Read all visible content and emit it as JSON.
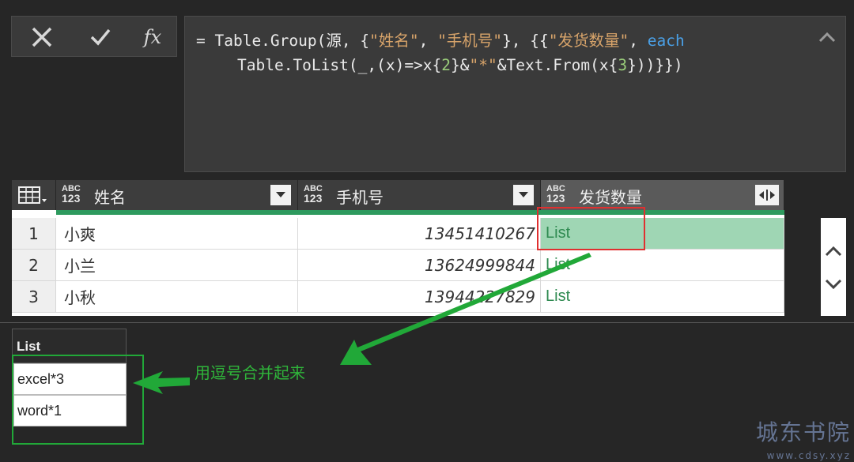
{
  "formula_bar": {
    "cancel_icon": "close-icon",
    "ok_icon": "check-icon",
    "fx_label": "fx",
    "line1": {
      "eq": "= Table.Group(源, {",
      "s1": "\"姓名\"",
      "c1": ", ",
      "s2": "\"手机号\"",
      "c2": "}, {{",
      "s3": "\"发货数量\"",
      "c3": ", ",
      "kw": "each"
    },
    "line2": {
      "a": "Table.ToList(_,(x)=>x{",
      "n1": "2",
      "b": "}&",
      "s": "\"*\"",
      "c": "&Text.From(x{",
      "n2": "3",
      "d": "}))}})"
    }
  },
  "columns": [
    {
      "type_top": "ABC",
      "type_bottom": "123",
      "label": "姓名"
    },
    {
      "type_top": "ABC",
      "type_bottom": "123",
      "label": "手机号"
    },
    {
      "type_top": "ABC",
      "type_bottom": "123",
      "label": "发货数量"
    }
  ],
  "rows": [
    {
      "index": "1",
      "name": "小爽",
      "phone": "13451410267",
      "value": "List"
    },
    {
      "index": "2",
      "name": "小兰",
      "phone": "13624999844",
      "value": "List"
    },
    {
      "index": "3",
      "name": "小秋",
      "phone": "13944227829",
      "value": "List"
    }
  ],
  "preview": {
    "header": "List",
    "items": [
      "excel*3",
      "word*1"
    ]
  },
  "annotation": "用逗号合并起来",
  "watermark": {
    "title": "城东书院",
    "url": "www.cdsy.xyz"
  },
  "colors": {
    "accent_green": "#21a838",
    "highlight_red": "#e03030",
    "selected_cell": "#9fd6b4"
  }
}
